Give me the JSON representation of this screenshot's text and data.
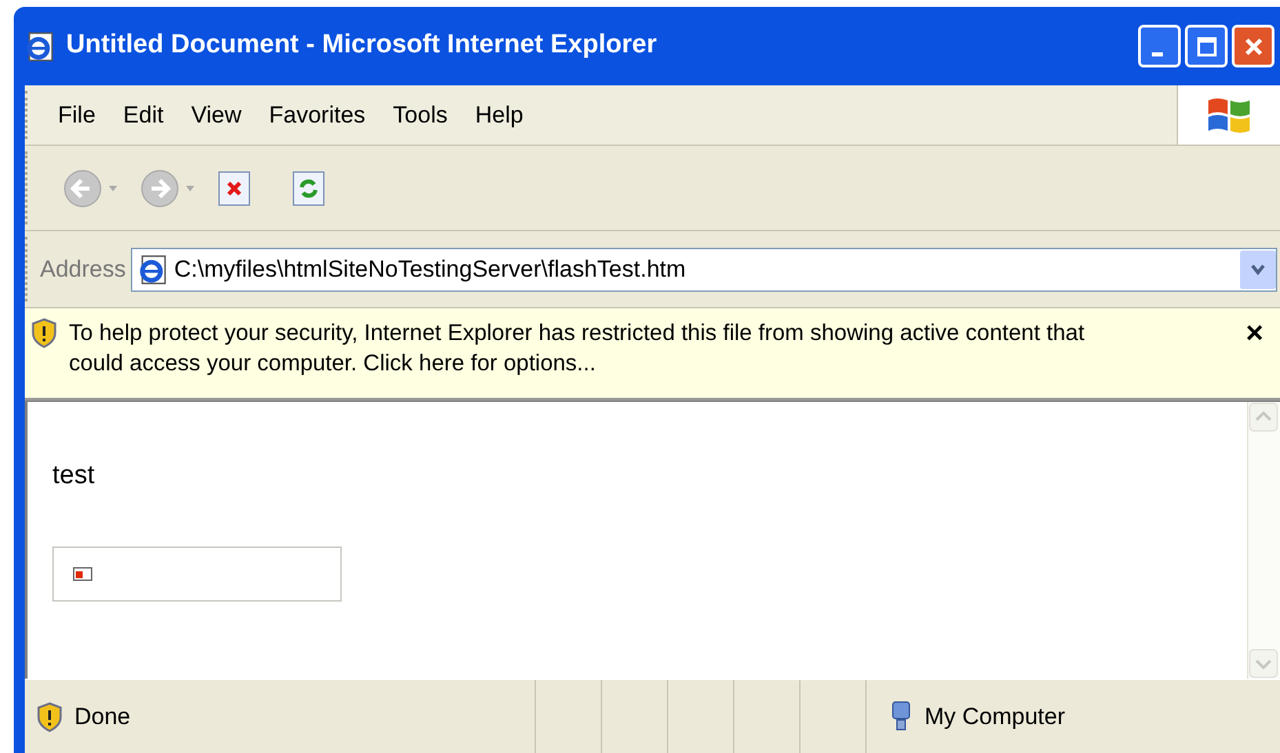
{
  "window": {
    "title": "Untitled Document - Microsoft Internet Explorer"
  },
  "menu": [
    "File",
    "Edit",
    "View",
    "Favorites",
    "Tools",
    "Help"
  ],
  "address": {
    "label": "Address",
    "value": "C:\\myfiles\\htmlSiteNoTestingServer\\flashTest.htm"
  },
  "info_bar": {
    "message": "To help protect your security, Internet Explorer has restricted this file from showing active content that could access your computer. Click here for options...",
    "close": "×"
  },
  "content": {
    "text": "test"
  },
  "status_bar": {
    "status": "Done",
    "zone": "My Computer"
  }
}
